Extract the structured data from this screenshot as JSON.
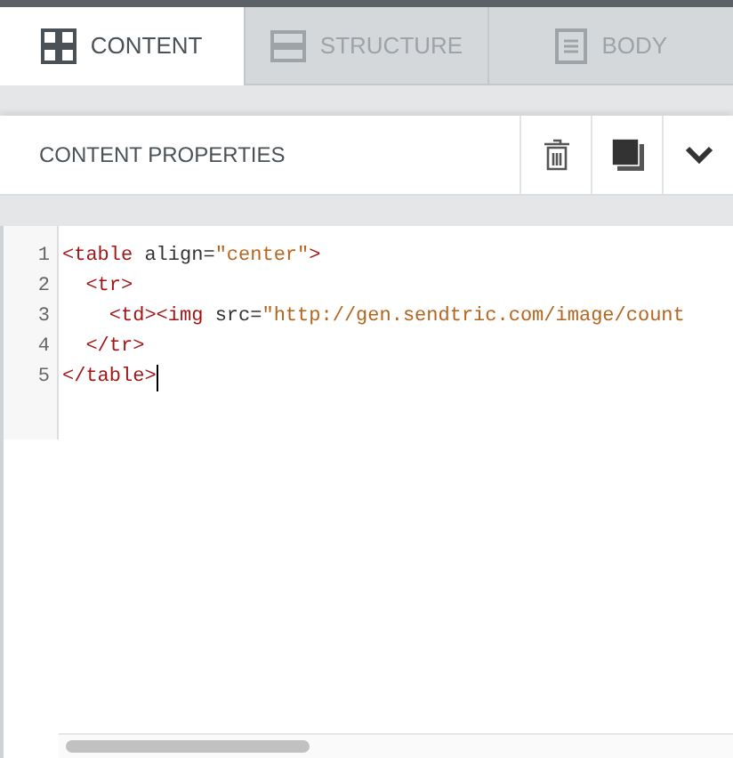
{
  "tabs": [
    {
      "kind": "grid",
      "label": "CONTENT",
      "selected": true
    },
    {
      "kind": "rows",
      "label": "STRUCTURE",
      "selected": false
    },
    {
      "kind": "page",
      "label": "BODY",
      "selected": false
    }
  ],
  "panel": {
    "title": "CONTENT PROPERTIES"
  },
  "editor": {
    "lines": [
      {
        "number": "1",
        "tokens": [
          {
            "kind": "tag",
            "text": "<table"
          },
          {
            "kind": "attr",
            "text": " align="
          },
          {
            "kind": "string",
            "text": "\"center\""
          },
          {
            "kind": "tag",
            "text": ">"
          }
        ]
      },
      {
        "number": "2",
        "tokens": [
          {
            "kind": "tag",
            "text": "  <tr>"
          }
        ]
      },
      {
        "number": "3",
        "tokens": [
          {
            "kind": "tag",
            "text": "    <td><img"
          },
          {
            "kind": "attr",
            "text": " src="
          },
          {
            "kind": "string",
            "text": "\"http://gen.sendtric.com/image/count"
          }
        ]
      },
      {
        "number": "4",
        "tokens": [
          {
            "kind": "tag",
            "text": "  </tr>"
          }
        ]
      },
      {
        "number": "5",
        "tokens": [
          {
            "kind": "tag",
            "text": "</table>"
          }
        ]
      }
    ]
  }
}
